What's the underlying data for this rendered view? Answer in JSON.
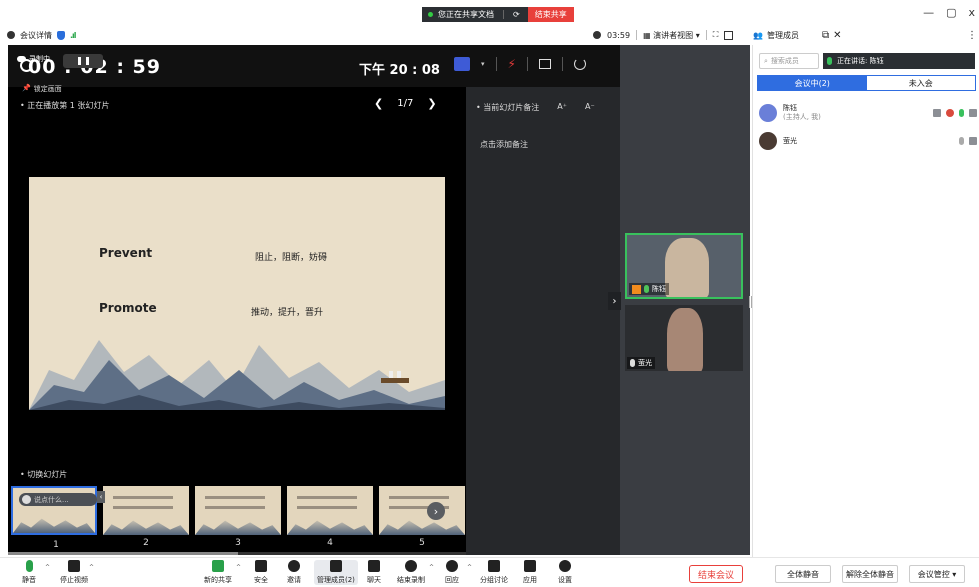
{
  "window": {
    "minimize": "—",
    "restore": "▢",
    "close": "x"
  },
  "share": {
    "status": "您正在共享文档",
    "end_label": "结束共享"
  },
  "topbar": {
    "meeting_info": "会议详情",
    "elapsed": "03:59",
    "view_mode": "演讲者视图",
    "members_title": "管理成员",
    "more": "⋮"
  },
  "presenter": {
    "recording": "录制中",
    "timer": "00 : 02 : 59",
    "time": "下午 20 : 08",
    "lock_label": "锁定画面",
    "now_playing": "正在播放第 1 张幻灯片",
    "page": "1/7",
    "notes_title": "当前幻灯片备注",
    "font_up": "A⁺",
    "font_down": "A⁻",
    "add_note": "点击添加备注",
    "switch_label": "切换幻灯片",
    "comment_placeholder": "说点什么..."
  },
  "slide": {
    "word1": "Prevent",
    "meaning1": "阻止，阻断，妨碍",
    "word2": "Promote",
    "meaning2": "推动，提升，晋升"
  },
  "thumbnails": [
    {
      "num": "1"
    },
    {
      "num": "2"
    },
    {
      "num": "3"
    },
    {
      "num": "4"
    },
    {
      "num": "5"
    }
  ],
  "participants_video": [
    {
      "name": "陈钰",
      "active": true
    },
    {
      "name": "萤光",
      "active": false
    }
  ],
  "members": {
    "search_placeholder": "搜索成员",
    "speaking": "正在讲话: 陈钰",
    "tab_in": "会议中(2)",
    "tab_out": "未入会",
    "list": [
      {
        "name": "陈钰",
        "role": "(主持人, 我)"
      },
      {
        "name": "萤光",
        "role": ""
      }
    ]
  },
  "toolbar": {
    "mute": "静音",
    "stop_video": "停止视频",
    "new_share": "新的共享",
    "security": "安全",
    "invite": "邀请",
    "manage_members": "管理成员(2)",
    "chat": "聊天",
    "end_recording": "结束录制",
    "reactions": "回应",
    "breakout": "分组讨论",
    "apps": "应用",
    "settings": "设置",
    "end_meeting": "结束会议",
    "mute_all": "全体静音",
    "unmute_all": "解除全体静音",
    "meeting_control": "会议管控 ▾"
  },
  "colors": {
    "accent": "#2f6de0",
    "danger": "#e8403b",
    "speaking_border": "#39c15d"
  }
}
